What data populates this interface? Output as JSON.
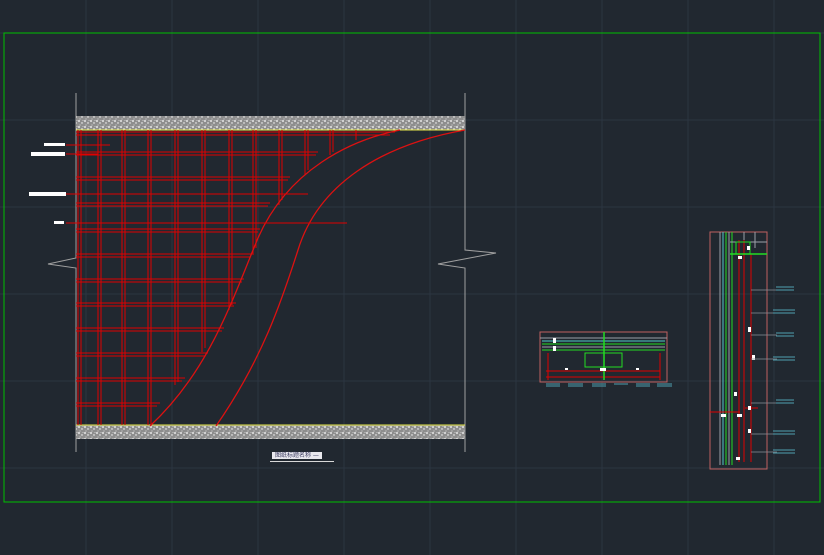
{
  "drawing": {
    "background": "#212830",
    "grid_color": "#2c3540",
    "frame_color": "#00c000",
    "hatch_color": "#d9d9d9",
    "rebar_color": "#e00000",
    "curve_color": "#cc1111",
    "accent_green": "#22dd22",
    "tag_color": "#50a0b0"
  },
  "elevation": {
    "title": "图纸标题名称 —",
    "leader_tags": [
      "",
      "",
      "",
      ""
    ]
  },
  "section_a": {
    "name": "horizontal-section-detail"
  },
  "section_b": {
    "name": "vertical-section-detail"
  }
}
